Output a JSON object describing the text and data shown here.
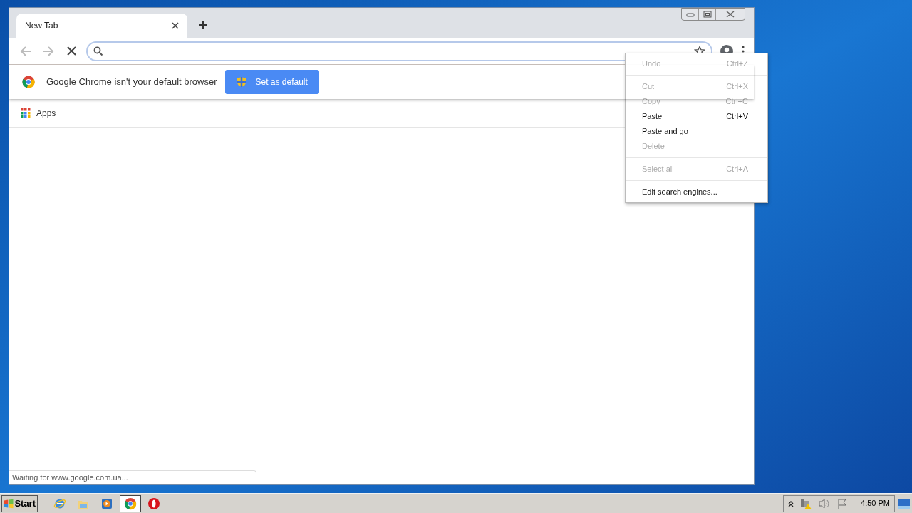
{
  "tabs": [
    {
      "title": "New Tab",
      "selected": true
    }
  ],
  "infobar": {
    "message": "Google Chrome isn't your default browser",
    "button": "Set as default"
  },
  "bookmarks": [
    {
      "label": "Apps"
    }
  ],
  "context_menu": [
    {
      "kind": "item",
      "label": "Undo",
      "shortcut": "Ctrl+Z",
      "disabled": true
    },
    {
      "kind": "separator"
    },
    {
      "kind": "item",
      "label": "Cut",
      "shortcut": "Ctrl+X",
      "disabled": true
    },
    {
      "kind": "item",
      "label": "Copy",
      "shortcut": "Ctrl+C",
      "disabled": true
    },
    {
      "kind": "item",
      "label": "Paste",
      "shortcut": "Ctrl+V",
      "disabled": false
    },
    {
      "kind": "item",
      "label": "Paste and go",
      "disabled": false
    },
    {
      "kind": "item",
      "label": "Delete",
      "disabled": true
    },
    {
      "kind": "separator"
    },
    {
      "kind": "item",
      "label": "Select all",
      "shortcut": "Ctrl+A",
      "disabled": true
    },
    {
      "kind": "separator"
    },
    {
      "kind": "item",
      "label": "Edit search engines...",
      "disabled": false
    }
  ],
  "status_bubble": "Waiting for www.google.com.ua...",
  "taskbar": {
    "start": "Start",
    "apps": [
      {
        "kind": "ie",
        "selected": false
      },
      {
        "kind": "folder",
        "selected": false
      },
      {
        "kind": "media",
        "selected": false
      },
      {
        "kind": "chrome",
        "selected": true
      },
      {
        "kind": "opera",
        "selected": false
      }
    ],
    "clock": "4:50 PM"
  }
}
